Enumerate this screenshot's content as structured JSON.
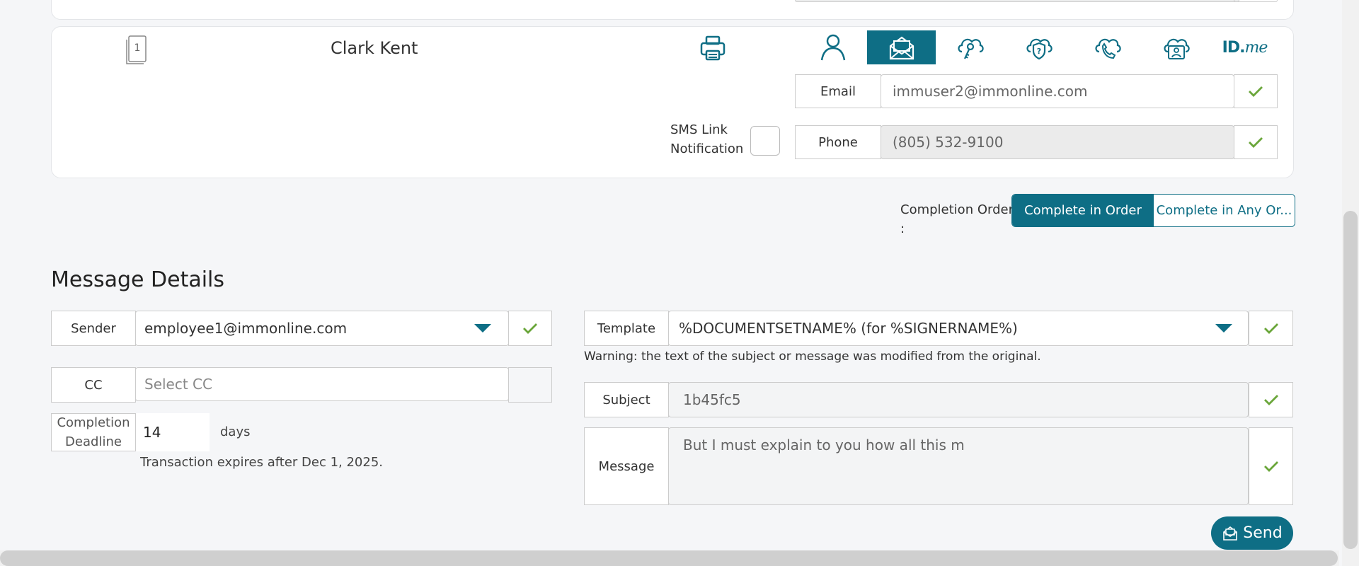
{
  "signer": {
    "order_number": "1",
    "name": "Clark Kent",
    "email_label": "Email",
    "email_value": "immuser2@immonline.com",
    "phone_label": "Phone",
    "phone_value": "(805) 532-9100",
    "sms_label_line1": "SMS Link",
    "sms_label_line2": "Notification",
    "sms_checked": false,
    "auth_icons": [
      "person-icon",
      "email-auth-icon",
      "key-cloud-icon",
      "shield-cloud-icon",
      "phone-cloud-icon",
      "id-card-cloud-icon",
      "idme-logo"
    ],
    "active_auth": "email-auth-icon",
    "idme_id": "ID.",
    "idme_me": "me"
  },
  "completion_order": {
    "label_line1": "Completion Order",
    "label_line2": ":",
    "in_order": "Complete in Order",
    "any_order": "Complete in Any Or...",
    "selected": "in_order"
  },
  "message_details": {
    "title": "Message Details",
    "sender_label": "Sender",
    "sender_value": "employee1@immonline.com",
    "cc_label": "CC",
    "cc_placeholder": "Select CC",
    "deadline_label_line1": "Completion",
    "deadline_label_line2": "Deadline",
    "deadline_value": "14",
    "deadline_unit": "days",
    "expiry_note": "Transaction expires after Dec 1, 2025.",
    "template_label": "Template",
    "template_value": "%DOCUMENTSETNAME% (for %SIGNERNAME%)",
    "warning": "Warning: the text of the subject or message was modified from the original.",
    "subject_label": "Subject",
    "subject_value": "1b45fc5",
    "message_label": "Message",
    "message_value": "But I must explain to you how all this m"
  },
  "send_label": "Send",
  "colors": {
    "accent": "#0e6e85",
    "check": "#6aa63a"
  }
}
